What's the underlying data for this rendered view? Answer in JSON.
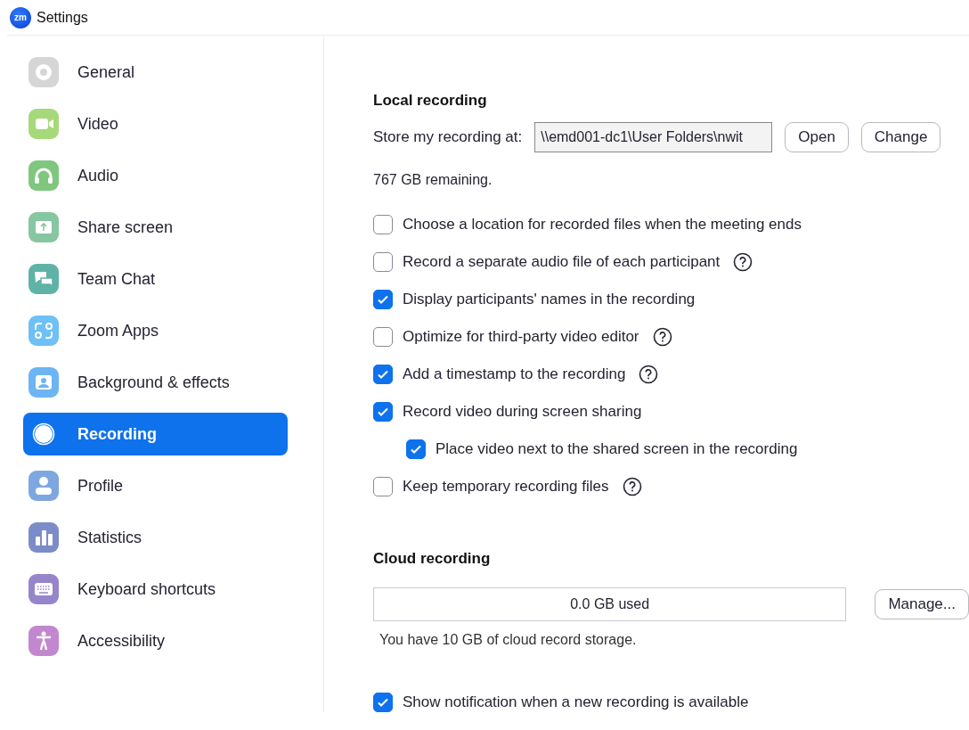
{
  "window": {
    "title": "Settings",
    "logo": "zm"
  },
  "sidebar": {
    "items": [
      {
        "label": "General",
        "selected": false
      },
      {
        "label": "Video",
        "selected": false
      },
      {
        "label": "Audio",
        "selected": false
      },
      {
        "label": "Share screen",
        "selected": false
      },
      {
        "label": "Team Chat",
        "selected": false
      },
      {
        "label": "Zoom Apps",
        "selected": false
      },
      {
        "label": "Background & effects",
        "selected": false
      },
      {
        "label": "Recording",
        "selected": true
      },
      {
        "label": "Profile",
        "selected": false
      },
      {
        "label": "Statistics",
        "selected": false
      },
      {
        "label": "Keyboard shortcuts",
        "selected": false
      },
      {
        "label": "Accessibility",
        "selected": false
      }
    ]
  },
  "local_recording": {
    "heading": "Local recording",
    "store_label": "Store my recording at:",
    "path": "\\\\emd001-dc1\\User Folders\\nwit",
    "buttons": [
      "Open",
      "Change"
    ],
    "remaining": "767 GB remaining.",
    "options": [
      {
        "label": "Choose a location for recorded files when the meeting ends",
        "checked": false,
        "help": false
      },
      {
        "label": "Record a separate audio file of each participant",
        "checked": false,
        "help": true
      },
      {
        "label": "Display participants' names in the recording",
        "checked": true,
        "help": false
      },
      {
        "label": "Optimize for third-party video editor",
        "checked": false,
        "help": true
      },
      {
        "label": "Add a timestamp to the recording",
        "checked": true,
        "help": true
      },
      {
        "label": "Record video during screen sharing",
        "checked": true,
        "help": false,
        "children": [
          {
            "label": "Place video next to the shared screen in the recording",
            "checked": true,
            "help": false
          }
        ]
      },
      {
        "label": "Keep temporary recording files",
        "checked": false,
        "help": true
      }
    ]
  },
  "cloud_recording": {
    "heading": "Cloud recording",
    "usage": {
      "text": "0.0 GB used"
    },
    "manage_button": "Manage...",
    "storage_note": "You have 10 GB of cloud record storage.",
    "options": [
      {
        "label": "Show notification when a new recording is available",
        "checked": true,
        "help": false
      }
    ]
  }
}
